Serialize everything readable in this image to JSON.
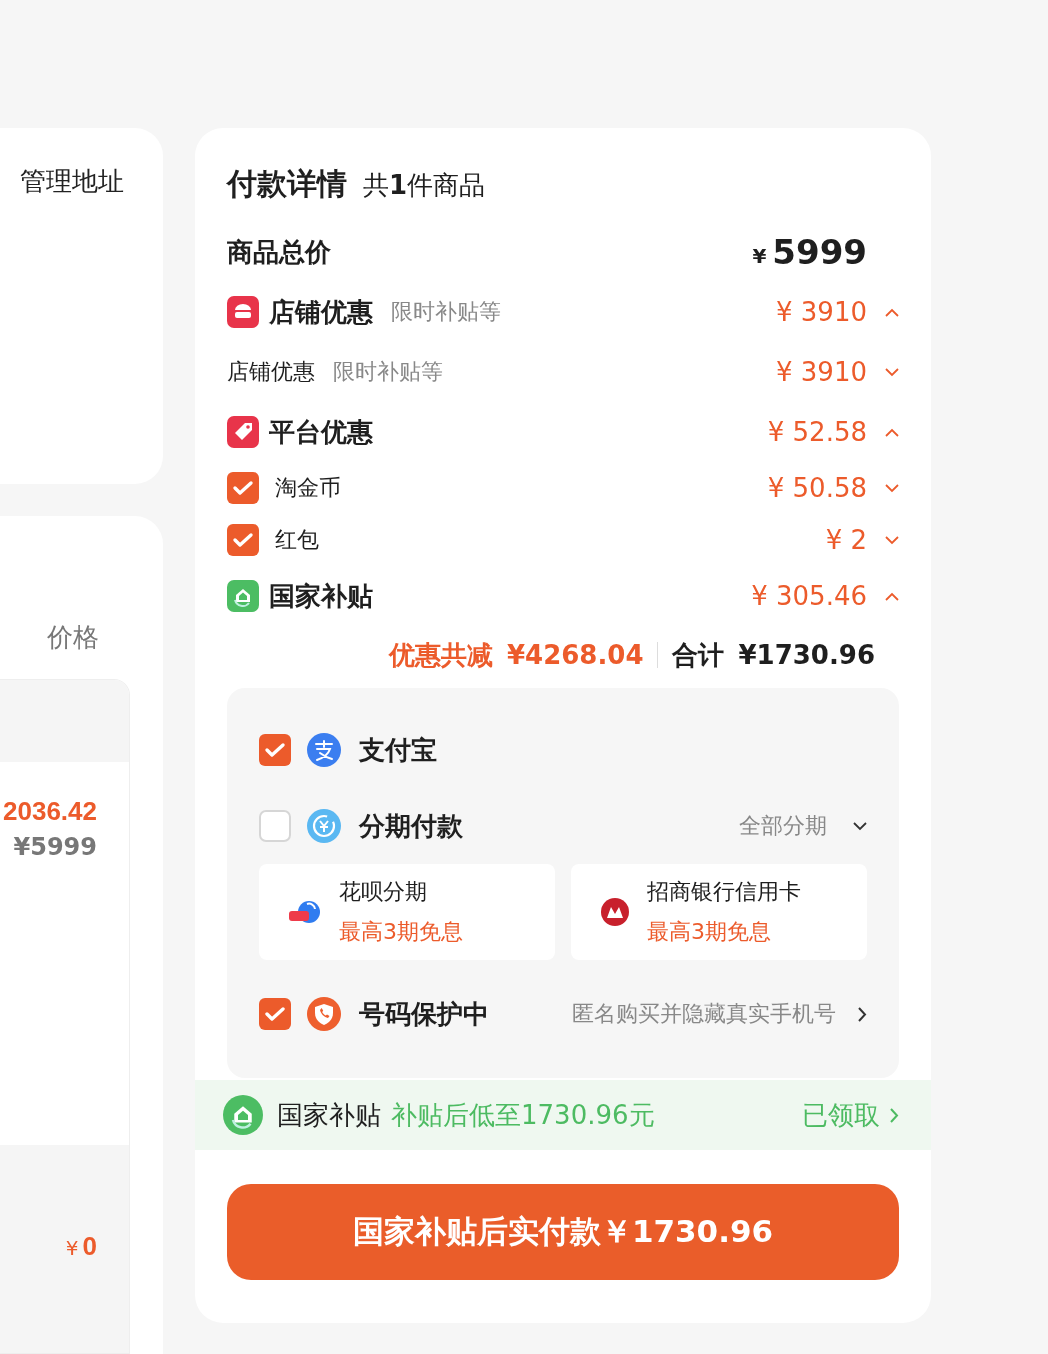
{
  "address_card": {
    "manage_link": "管理地址"
  },
  "order_card": {
    "price_header": "价格",
    "item_price": "2036.42",
    "item_original_price": "¥5999",
    "footer_currency": "¥",
    "footer_amount": "0"
  },
  "details": {
    "title": "付款详情",
    "count_prefix": "共",
    "count": "1",
    "count_suffix": "件商品",
    "lines": [
      {
        "kind": "total",
        "label": "商品总价",
        "currency": "¥",
        "amount": "5999"
      },
      {
        "kind": "store",
        "label": "店铺优惠",
        "note": "限时补贴等",
        "amount": "¥ 3910",
        "expanded": true
      },
      {
        "kind": "sub",
        "label": "店铺优惠",
        "note": "限时补贴等",
        "amount": "¥ 3910",
        "expanded": false
      },
      {
        "kind": "platform",
        "label": "平台优惠",
        "amount": "¥ 52.58",
        "expanded": true
      },
      {
        "kind": "check",
        "label": "淘金币",
        "checked": true,
        "amount": "¥ 50.58",
        "expanded": false
      },
      {
        "kind": "check",
        "label": "红包",
        "checked": true,
        "amount": "¥ 2",
        "expanded": false
      },
      {
        "kind": "subsidy",
        "label": "国家补贴",
        "amount": "¥ 305.46",
        "expanded": true
      }
    ],
    "discount_label": "优惠共减",
    "discount_amount": "¥4268.04",
    "total_label": "合计",
    "total_amount": "¥1730.96"
  },
  "payment": {
    "methods": [
      {
        "kind": "wallet",
        "label": "支付宝",
        "checked": true
      },
      {
        "kind": "installment",
        "label": "分期付款",
        "checked": false,
        "option": "全部分期"
      },
      {
        "kind": "cards",
        "plans": [
          {
            "name": "花呗分期",
            "offer": "最高3期免息"
          },
          {
            "name": "招商银行信用卡",
            "offer": "最高3期免息"
          }
        ]
      },
      {
        "kind": "privacy",
        "label": "号码保护中",
        "checked": true,
        "note": "匿名购买并隐藏真实手机号"
      }
    ]
  },
  "subsidy_bar": {
    "label": "国家补贴",
    "note": "补贴后低至1730.96元",
    "status": "已领取"
  },
  "pay_button": "国家补贴后实付款￥1730.96"
}
